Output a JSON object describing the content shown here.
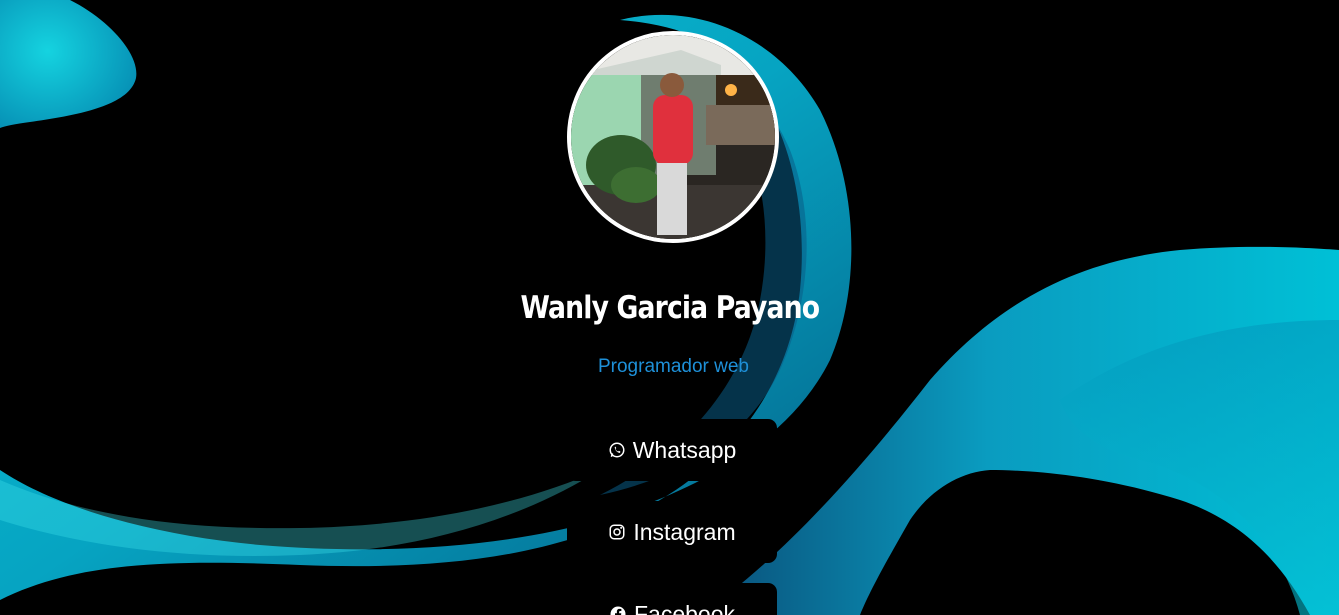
{
  "profile": {
    "name": "Wanly Garcia Payano",
    "subtitle": "Programador web"
  },
  "links": {
    "whatsapp": {
      "label": "Whatsapp",
      "icon": "whatsapp-icon"
    },
    "instagram": {
      "label": "Instagram",
      "icon": "instagram-icon"
    },
    "facebook": {
      "label": "Facebook",
      "icon": "facebook-icon"
    }
  },
  "colors": {
    "background": "#000000",
    "accent_wave": "#00b3cc",
    "subtitle": "#1e90d8",
    "button_bg": "#000000",
    "text": "#ffffff"
  }
}
